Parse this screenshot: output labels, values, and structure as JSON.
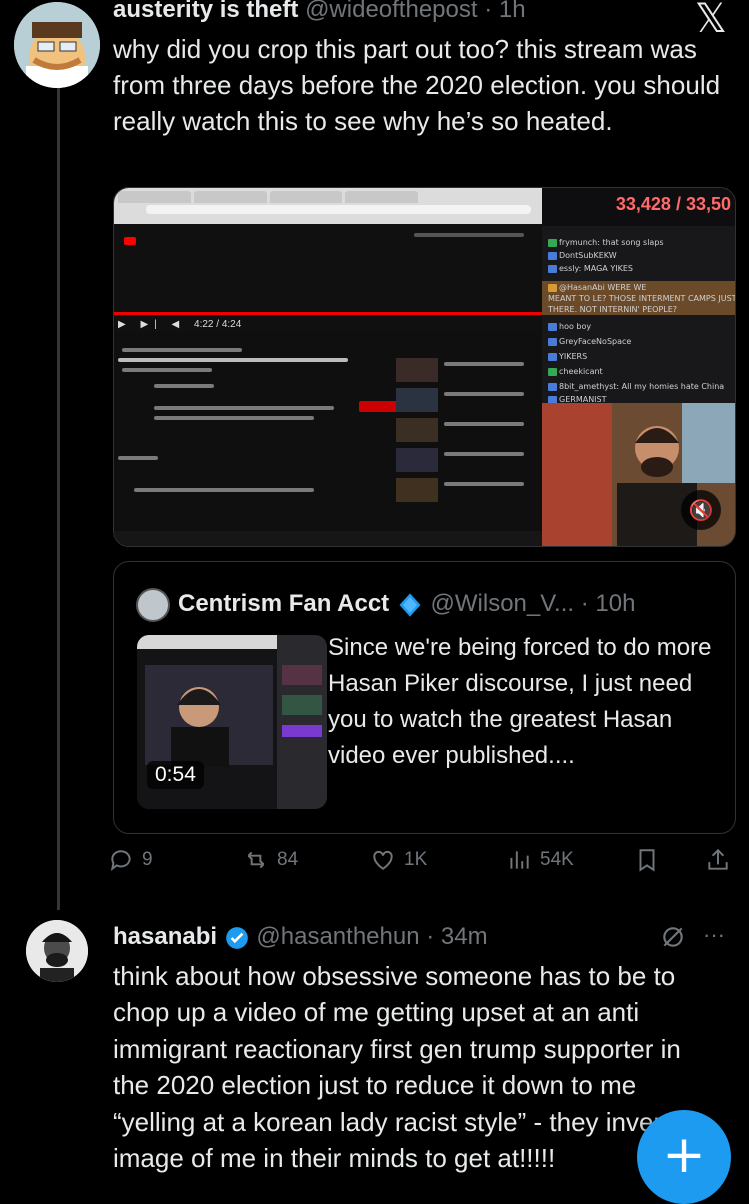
{
  "tweet1": {
    "display_name": "austerity is theft",
    "handle": "@wideofthepost",
    "time": "· 1h",
    "text": "why did you crop this part out too? this stream was from three days before the 2020 election. you should really watch this to see why he’s so heated.",
    "media": {
      "viewer_count": "33,428 / 33,50",
      "player_time": "4:22 / 4:24",
      "chat_lines": [
        "frymunch: that song slaps",
        "DontSubKEKW",
        "essly: MAGA YIKES",
        "@HasanAbi WERE WE",
        "MEANT TO LE? THOSE INTERMENT CAMPS JUST SIT",
        "THERE. NOT INTERNIN' PEOPLE?",
        "hoo boy",
        "GreyFaceNoSpace",
        "YIKERS",
        "cheekicant",
        "8bit_amethyst: All my homies hate China",
        "GERMANIST"
      ]
    }
  },
  "quote": {
    "display_name": "Centrism Fan Acct",
    "handle": "@Wilson_V...",
    "time": "· 10h",
    "video_duration": "0:54",
    "text": "Since we're being forced to do more Hasan Piker discourse, I just need you to watch the greatest Hasan video ever published...."
  },
  "actions": {
    "replies": "9",
    "reposts": "84",
    "likes": "1K",
    "views": "54K"
  },
  "tweet2": {
    "display_name": "hasanabi",
    "handle": "@hasanthehun",
    "time": "· 34m",
    "more": "···",
    "text": "think about how obsessive someone has to be to chop up a video of me getting upset at an anti immigrant reactionary first gen trump supporter in the 2020 election just to reduce it down to me “yelling at a korean lady racist style” - they invent an image of me in their minds to get at!!!!!"
  },
  "colors": {
    "accent": "#1d9bf0",
    "muted": "#71767b",
    "background": "#000000",
    "gold_badge": "#e8a600"
  },
  "icons": [
    "x-logo-icon",
    "verified-badge-icon",
    "reply-icon",
    "repost-icon",
    "like-icon",
    "views-icon",
    "bookmark-icon",
    "share-icon",
    "grok-icon",
    "compose-plus-icon",
    "mute-icon"
  ]
}
